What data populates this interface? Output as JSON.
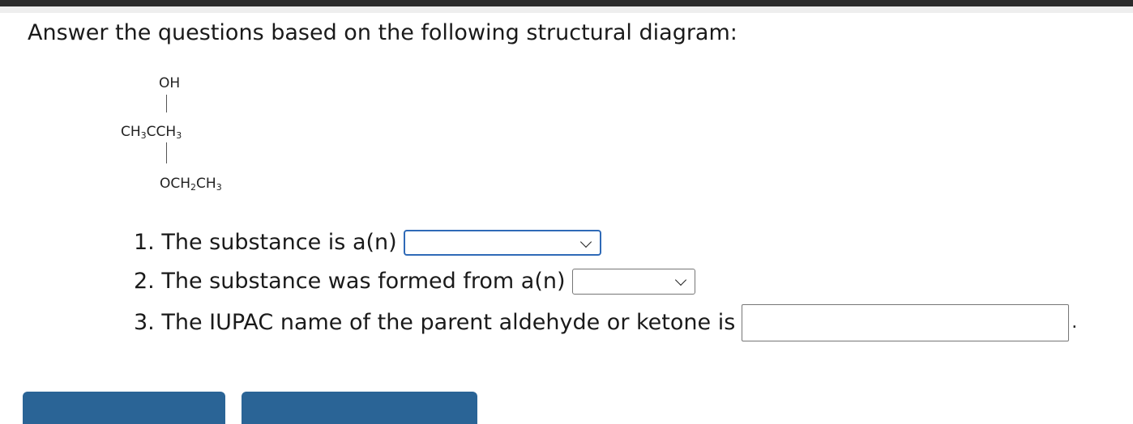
{
  "prompt": "Answer the questions based on the following structural diagram:",
  "structure": {
    "top_group": "OH",
    "middle_left": "CH",
    "middle_left_sub": "3",
    "middle_center": "C",
    "middle_right": "CH",
    "middle_right_sub": "3",
    "bottom_a": "OCH",
    "bottom_a_sub": "2",
    "bottom_b": "CH",
    "bottom_b_sub": "3"
  },
  "questions": [
    {
      "label": "1. The substance is a(n)",
      "value": ""
    },
    {
      "label": "2. The substance was formed from a(n)",
      "value": ""
    },
    {
      "label": "3. The IUPAC name of the parent aldehyde or ketone is",
      "value": "",
      "trailing": "."
    }
  ],
  "colors": {
    "focus_border": "#2f6ab7",
    "button_blue": "#2a6496"
  }
}
